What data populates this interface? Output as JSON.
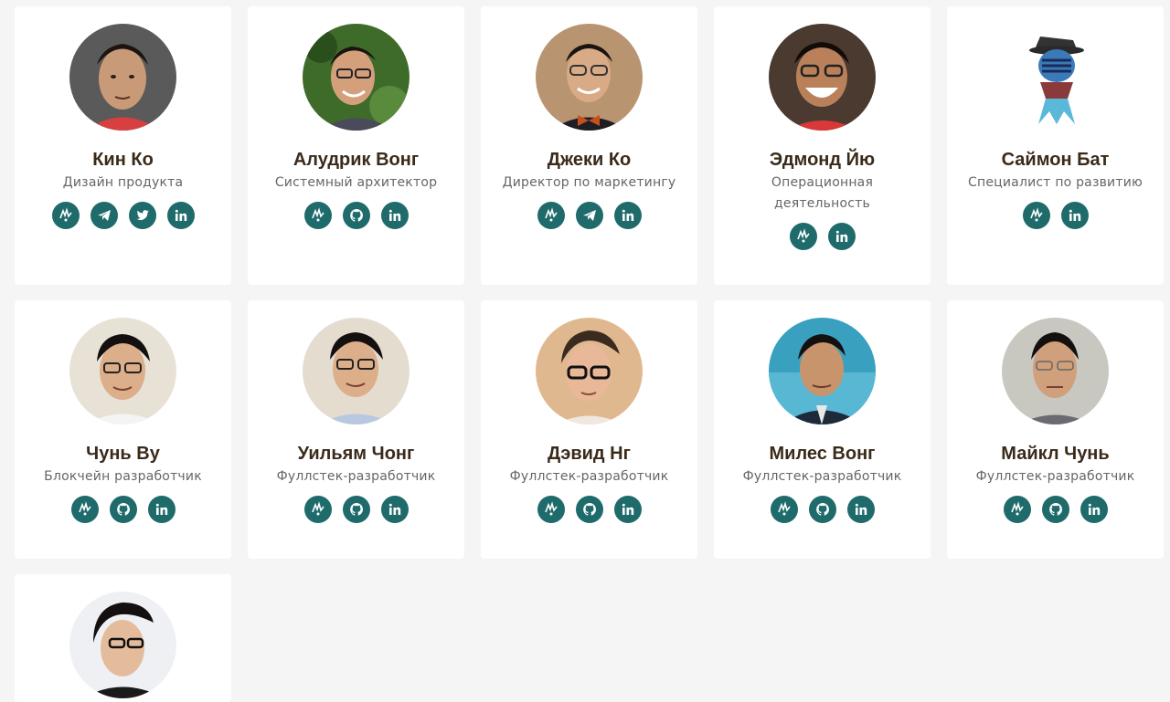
{
  "colors": {
    "accent": "#1f6b6b",
    "name": "#3a2a1a",
    "role": "#666666",
    "background": "#f5f5f5",
    "card": "#ffffff"
  },
  "team": [
    {
      "name": "Кин Ко",
      "role": "Дизайн продукта",
      "socials": [
        "jumpstart-icon",
        "telegram-icon",
        "twitter-icon",
        "linkedin-icon"
      ]
    },
    {
      "name": "Алудрик Вонг",
      "role": "Системный архитектор",
      "socials": [
        "jumpstart-icon",
        "github-icon",
        "linkedin-icon"
      ]
    },
    {
      "name": "Джеки Ко",
      "role": "Директор по маркетингу",
      "socials": [
        "jumpstart-icon",
        "telegram-icon",
        "linkedin-icon"
      ]
    },
    {
      "name": "Эдмонд Йю",
      "role": "Операционная деятельность",
      "socials": [
        "jumpstart-icon",
        "linkedin-icon"
      ]
    },
    {
      "name": "Саймон Бат",
      "role": "Специалист по развитию",
      "socials": [
        "jumpstart-icon",
        "linkedin-icon"
      ]
    },
    {
      "name": "Чунь Ву",
      "role": "Блокчейн разработчик",
      "socials": [
        "jumpstart-icon",
        "github-icon",
        "linkedin-icon"
      ]
    },
    {
      "name": "Уильям Чонг",
      "role": "Фуллстек-разработчик",
      "socials": [
        "jumpstart-icon",
        "github-icon",
        "linkedin-icon"
      ]
    },
    {
      "name": "Дэвид Нг",
      "role": "Фуллстек-разработчик",
      "socials": [
        "jumpstart-icon",
        "github-icon",
        "linkedin-icon"
      ]
    },
    {
      "name": "Милес Вонг",
      "role": "Фуллстек-разработчик",
      "socials": [
        "jumpstart-icon",
        "github-icon",
        "linkedin-icon"
      ]
    },
    {
      "name": "Майкл Чунь",
      "role": "Фуллстек-разработчик",
      "socials": [
        "jumpstart-icon",
        "github-icon",
        "linkedin-icon"
      ]
    },
    {
      "name": "",
      "role": "",
      "socials": []
    }
  ]
}
